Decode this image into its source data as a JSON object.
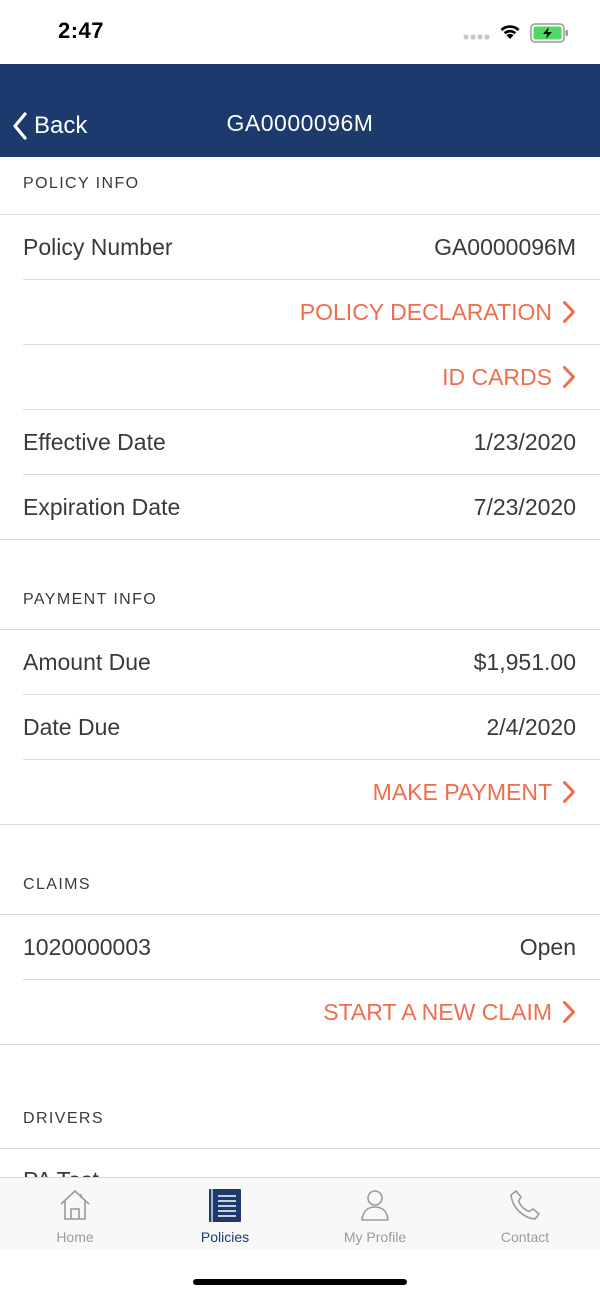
{
  "status_bar": {
    "time": "2:47"
  },
  "nav": {
    "back_label": "Back",
    "title": "GA0000096M"
  },
  "policy_info": {
    "header": "POLICY INFO",
    "policy_number_label": "Policy Number",
    "policy_number_value": "GA0000096M",
    "declaration_link": "POLICY DECLARATION",
    "id_cards_link": "ID CARDS",
    "effective_date_label": "Effective Date",
    "effective_date_value": "1/23/2020",
    "expiration_date_label": "Expiration Date",
    "expiration_date_value": "7/23/2020"
  },
  "payment_info": {
    "header": "PAYMENT INFO",
    "amount_due_label": "Amount Due",
    "amount_due_value": "$1,951.00",
    "date_due_label": "Date Due",
    "date_due_value": "2/4/2020",
    "make_payment_link": "MAKE PAYMENT"
  },
  "claims": {
    "header": "CLAIMS",
    "items": [
      {
        "number": "1020000003",
        "status": "Open"
      }
    ],
    "new_claim_link": "START A NEW CLAIM"
  },
  "drivers": {
    "header": "DRIVERS",
    "items": [
      {
        "name": "PA Test"
      }
    ]
  },
  "tabs": [
    {
      "label": "Home",
      "icon": "home-icon"
    },
    {
      "label": "Policies",
      "icon": "policies-icon",
      "active": true
    },
    {
      "label": "My Profile",
      "icon": "profile-icon"
    },
    {
      "label": "Contact",
      "icon": "phone-icon"
    }
  ],
  "colors": {
    "nav_bg": "#1c3b6c",
    "link": "#ef6d4f",
    "battery": "#4cd964"
  }
}
